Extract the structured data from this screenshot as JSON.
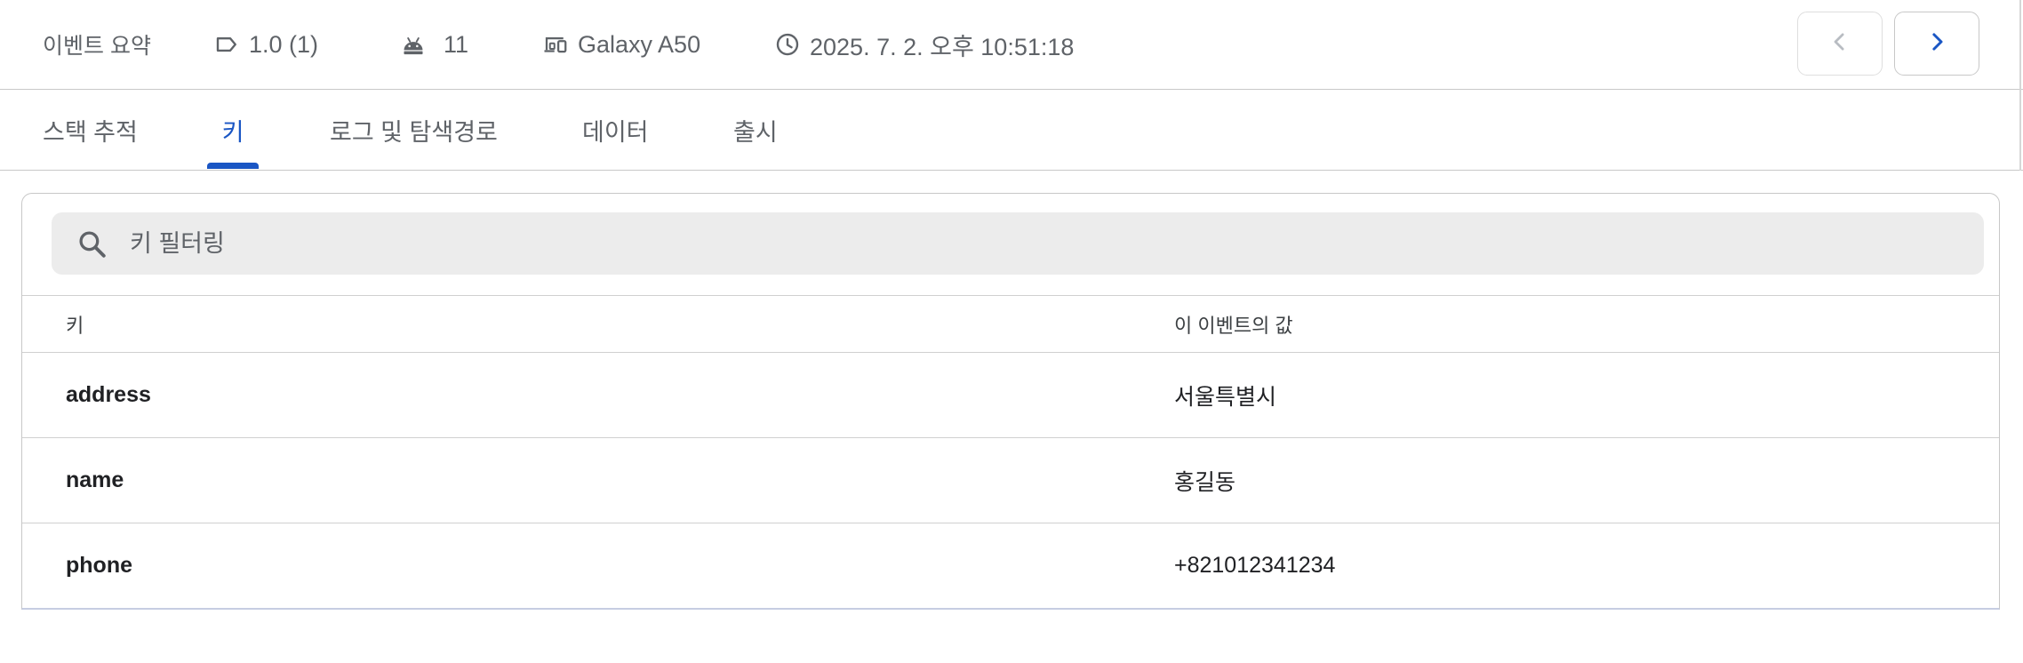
{
  "summary": {
    "title": "이벤트 요약",
    "version": "1.0 (1)",
    "os_version": "11",
    "device": "Galaxy A50",
    "timestamp": "2025. 7. 2. 오후 10:51:18"
  },
  "icons": {
    "version": "label-icon",
    "os": "android-icon",
    "device": "devices-icon",
    "time": "clock-icon",
    "prev": "chevron-left-icon",
    "next": "chevron-right-icon",
    "search": "search-icon"
  },
  "colors": {
    "accent": "#1a56c4",
    "search_bg": "#ececec",
    "border": "#c8c8c8"
  },
  "tabs": [
    {
      "label": "스택 추적"
    },
    {
      "label": "키",
      "active": true
    },
    {
      "label": "로그 및 탐색경로"
    },
    {
      "label": "데이터"
    },
    {
      "label": "출시"
    }
  ],
  "search": {
    "placeholder": "키 필터링",
    "value": ""
  },
  "table": {
    "columns": [
      "키",
      "이 이벤트의 값"
    ],
    "rows": [
      {
        "key": "address",
        "value": "서울특별시"
      },
      {
        "key": "name",
        "value": "홍길동"
      },
      {
        "key": "phone",
        "value": "+821012341234"
      }
    ]
  }
}
